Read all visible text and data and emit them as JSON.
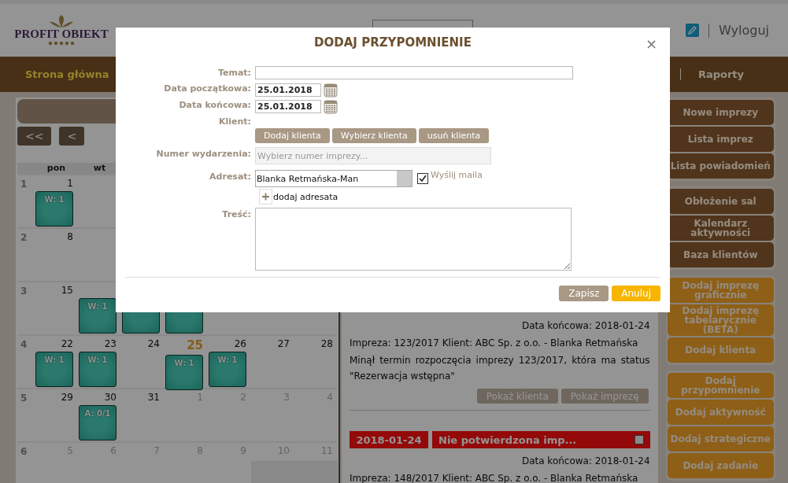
{
  "header": {
    "logo": "PROFIT OBIEKT",
    "logout": "Wyloguj"
  },
  "nav": [
    {
      "label": "Strona główna",
      "selected": true
    },
    {
      "label": "Raporty",
      "selected": false
    }
  ],
  "calendar": {
    "prev_year": "<<",
    "prev": "<",
    "weekdays": [
      "pon",
      "wt"
    ],
    "weeks": [
      {
        "week": "1",
        "days": [
          {
            "day": "1",
            "kind": "current",
            "has_event": true,
            "event": "W: 1"
          }
        ]
      },
      {
        "week": "2",
        "days": [
          {
            "day": "8",
            "kind": "current",
            "has_event": false
          }
        ]
      },
      {
        "week": "3",
        "days": [
          {
            "day": "15",
            "kind": "current",
            "has_event": false
          },
          {
            "kind": "current",
            "has_event": true,
            "event": "W: 1"
          },
          {
            "kind": "current",
            "has_event": true
          },
          {
            "kind": "current",
            "has_event": true
          }
        ]
      },
      {
        "week": "4",
        "days": [
          {
            "day": "22",
            "kind": "current",
            "has_event": true,
            "event": "W: 1"
          },
          {
            "day": "23",
            "kind": "current",
            "has_event": true,
            "event": "W: 1"
          },
          {
            "day": "24",
            "kind": "current",
            "has_event": false
          },
          {
            "day": "25",
            "kind": "today",
            "has_event": true,
            "event": "W: 1"
          },
          {
            "day": "26",
            "kind": "current",
            "has_event": true,
            "event": "W: 1"
          },
          {
            "day": "27",
            "kind": "current",
            "has_event": false
          },
          {
            "day": "28",
            "kind": "current",
            "has_event": false
          }
        ]
      },
      {
        "week": "5",
        "days": [
          {
            "day": "29",
            "kind": "current",
            "has_event": false
          },
          {
            "day": "30",
            "kind": "current",
            "has_event": true,
            "event": "A: 0/1"
          },
          {
            "day": "31",
            "kind": "current",
            "has_event": false
          },
          {
            "day": "1",
            "kind": "other",
            "has_event": false
          },
          {
            "day": "2",
            "kind": "other",
            "has_event": false
          },
          {
            "day": "3",
            "kind": "other",
            "has_event": false
          },
          {
            "day": "4",
            "kind": "other",
            "has_event": false
          }
        ]
      },
      {
        "week": "6",
        "days": [
          {
            "day": "5",
            "kind": "other",
            "has_event": false
          },
          {
            "day": "6",
            "kind": "other",
            "has_event": false
          },
          {
            "day": "7",
            "kind": "other",
            "has_event": false
          },
          {
            "day": "8",
            "kind": "other",
            "has_event": false
          },
          {
            "day": "9",
            "kind": "other",
            "has_event": false
          },
          {
            "day": "10",
            "kind": "shaded",
            "has_event": false
          },
          {
            "day": "11",
            "kind": "shaded",
            "has_event": false
          }
        ]
      }
    ]
  },
  "notifications": [
    {
      "end_date": "Data końcowa: 2018-01-24",
      "summary": "Impreza: 123/2017 Klient: ABC Sp. z o.o. - Blanka Retmańska",
      "message": "Minął termin rozpoczęcia imprezy 123/2017, która ma status \"Rezerwacja wstępna\"",
      "actions": [
        "Pokaż klienta",
        "Pokaż imprezę"
      ]
    },
    {
      "date": "2018-01-24",
      "title": "Nie potwierdzona imp...",
      "checked": false,
      "end_date": "Data końcowa: 2018-01-24",
      "summary": "Impreza: 148/2017 Klient: ABC Sp. z o.o. - Blanka Retmańska"
    }
  ],
  "sidebar": [
    {
      "kind": "dark",
      "items": [
        "Nowe imprezy",
        "Lista imprez",
        "Lista powiadomień"
      ]
    },
    {
      "kind": "dark",
      "items": [
        "Obłożenie sal",
        "Kalendarz aktywności",
        "Baza klientów"
      ]
    },
    {
      "kind": "accent",
      "items": [
        "Dodaj imprezę graficznie",
        "Dodaj imprezę tabelarycznie (BETA)",
        "Dodaj klienta"
      ]
    },
    {
      "kind": "accent",
      "items": [
        "Dodaj przypomnienie",
        "Dodaj aktywność",
        "Dodaj strategiczne",
        "Dodaj zadanie"
      ]
    }
  ],
  "dialog": {
    "title": "DODAJ PRZYPOMNIENIE",
    "close": "×",
    "fields": [
      {
        "kind": "text",
        "label": "Temat:"
      },
      {
        "kind": "date",
        "label": "Data początkowa:",
        "value": "25.01.2018"
      },
      {
        "kind": "date",
        "label": "Data końcowa:",
        "value": "25.01.2018"
      },
      {
        "kind": "buttons",
        "label": "Klient:",
        "buttons": [
          "Dodaj klienta",
          "Wybierz klienta",
          "usuń klienta"
        ]
      },
      {
        "kind": "select",
        "label": "Numer wydarzenia:",
        "placeholder": "Wybierz numer imprezy...",
        "disabled": true
      },
      {
        "kind": "recipient",
        "label": "Adresat:",
        "value": "Blanka Retmańska-Man",
        "send_mail": {
          "label": "Wyślij maila",
          "checked": true
        },
        "add": "dodaj adresata"
      },
      {
        "kind": "textarea",
        "label": "Treść:"
      }
    ],
    "buttons": [
      {
        "label": "Zapisz",
        "kind": "secondary"
      },
      {
        "label": "Anuluj",
        "kind": "primary"
      }
    ]
  }
}
